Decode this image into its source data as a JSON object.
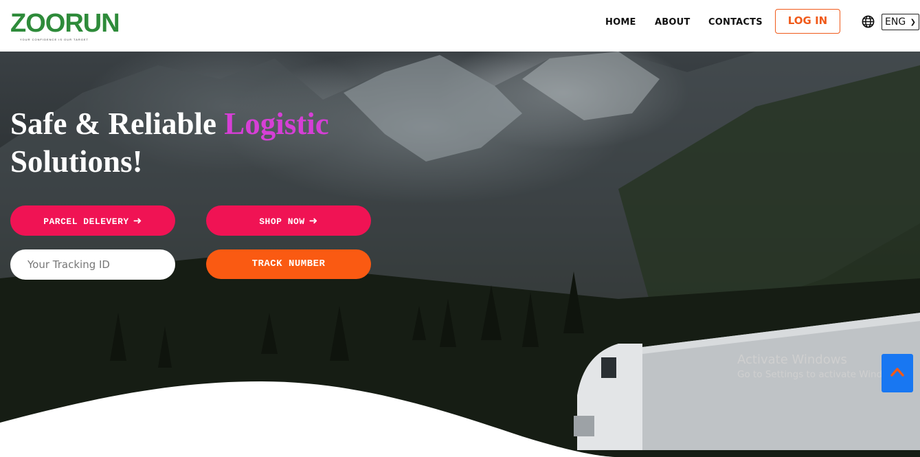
{
  "header": {
    "logo_text": "ZOORUN",
    "logo_tagline": "YOUR CONFIDENCE IS OUR TARGET",
    "nav": [
      "HOME",
      "ABOUT",
      "CONTACTS"
    ],
    "login_label": "LOG IN",
    "language": "ENG"
  },
  "hero": {
    "title_part1": "Safe & Reliable ",
    "title_highlight": "Logistic",
    "title_part2": "Solutions!",
    "parcel_button": "PARCEL DELEVERY",
    "shop_button": "SHOP NOW",
    "tracking_placeholder": "Your Tracking ID",
    "track_button": "TRACK NUMBER"
  },
  "overlay": {
    "activate_title": "Activate Windows",
    "activate_sub": "Go to Settings to activate Windows."
  },
  "colors": {
    "accent_pink": "#f01354",
    "accent_orange": "#fa5a12",
    "highlight_magenta": "#d63fd6",
    "brand_green": "#2e8b3a",
    "scroll_top_blue": "#1877f2"
  },
  "icons": [
    "globe-icon",
    "arrow-right-icon",
    "chevron-up-icon",
    "chevron-down-icon"
  ]
}
